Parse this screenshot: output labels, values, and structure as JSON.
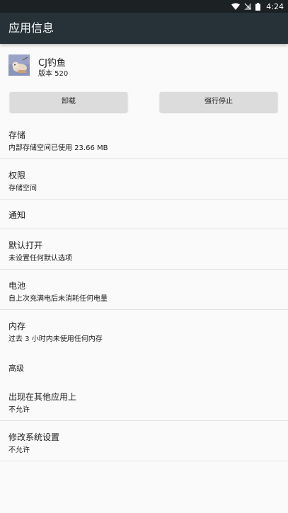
{
  "status_bar": {
    "time": "4:24",
    "icons": [
      "wifi-icon",
      "no-signal-icon",
      "battery-icon"
    ]
  },
  "app_bar": {
    "title": "应用信息"
  },
  "app": {
    "name": "CJ钓鱼",
    "version": "版本 520"
  },
  "buttons": {
    "uninstall": "卸载",
    "force_stop": "强行停止"
  },
  "settings": {
    "storage": {
      "title": "存储",
      "summary": "内部存储空间已使用 23.66 MB"
    },
    "permissions": {
      "title": "权限",
      "summary": "存储空间"
    },
    "notifications": {
      "title": "通知"
    },
    "open_by_default": {
      "title": "默认打开",
      "summary": "未设置任何默认选项"
    },
    "battery": {
      "title": "电池",
      "summary": "自上次充满电后未消耗任何电量"
    },
    "memory": {
      "title": "内存",
      "summary": "过去 3 小时内未使用任何内存"
    },
    "advanced_header": "高级",
    "draw_over_apps": {
      "title": "出现在其他应用上",
      "summary": "不允许"
    },
    "modify_system_settings": {
      "title": "修改系统设置",
      "summary": "不允许"
    }
  },
  "colors": {
    "status_bar": "#1c2124",
    "app_bar": "#263238",
    "background": "#fafafa",
    "button": "#dcdcdc",
    "divider": "#e2e2e2"
  }
}
